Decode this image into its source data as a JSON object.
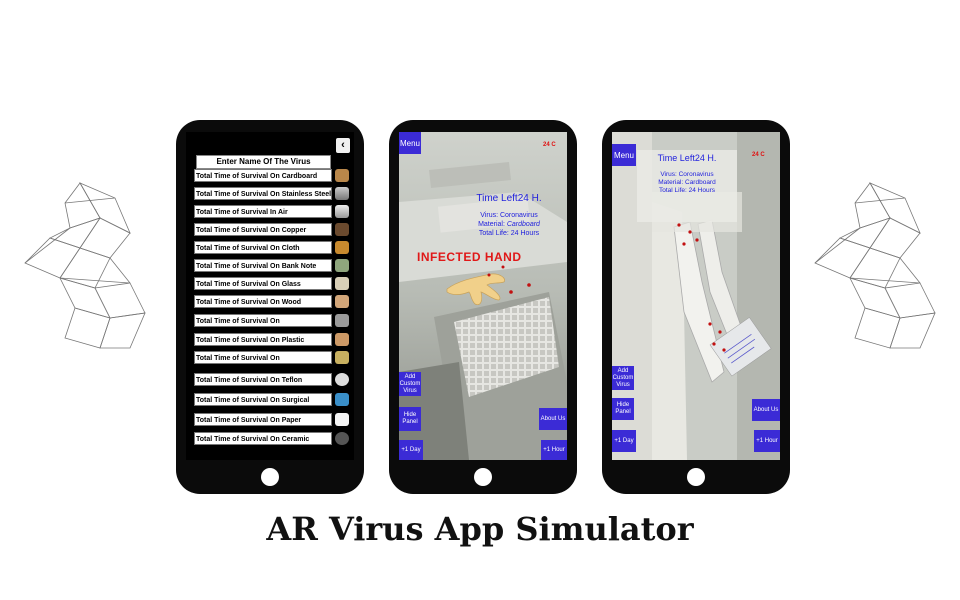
{
  "caption": "AR Virus App Simulator",
  "phone1": {
    "back_icon": "back-arrow-icon",
    "title": "Enter Name Of The Virus",
    "items": [
      {
        "label": "Total Time of Survival On Cardboard",
        "icon": "cardboard-icon"
      },
      {
        "label": "Total Time of Survival On Stainless Steel",
        "icon": "steel-icon"
      },
      {
        "label": "Total Time of Survival In Air",
        "icon": "air-icon"
      },
      {
        "label": "Total Time of Survival On Copper",
        "icon": "copper-icon"
      },
      {
        "label": "Total Time of Survival On Cloth",
        "icon": "cloth-icon"
      },
      {
        "label": "Total Time of Survival On Bank Note",
        "icon": "banknote-icon"
      },
      {
        "label": "Total Time of Survival On Glass",
        "icon": "glass-icon"
      },
      {
        "label": "Total Time of Survival On Wood",
        "icon": "wood-icon"
      },
      {
        "label": "Total Time of Survival On",
        "icon": "bin-icon"
      },
      {
        "label": "Total Time of Survival On Plastic",
        "icon": "plastic-icon"
      },
      {
        "label": "Total Time of Survival On",
        "icon": "bottle-icon"
      },
      {
        "label": "Total Time of Survival On Teflon",
        "icon": "teflon-icon"
      },
      {
        "label": "Total Time of Survival On Surgical",
        "icon": "surgical-icon"
      },
      {
        "label": "Total Time of Survival On Paper",
        "icon": "paper-icon"
      },
      {
        "label": "Total Time of Survival On Ceramic",
        "icon": "ceramic-icon"
      }
    ]
  },
  "phone2": {
    "menu": "Menu",
    "temperature": "24 C",
    "time_left": "Time Left24 H.",
    "virus": "Virus: Coronavirus",
    "material_label": "Material: ",
    "material_value": "Cardboard",
    "total_life": "Total Life: 24 Hours",
    "infected": "INFECTED HAND",
    "add_custom": "Add Custom Virus",
    "hide_panel": "Hide Panel",
    "about_us": "About Us",
    "plus_day": "+1 Day",
    "plus_hour": "+1 Hour"
  },
  "phone3": {
    "menu": "Menu",
    "temperature": "24 C",
    "time_left": "Time Left24 H.",
    "virus": "Virus: Coronavirus",
    "material": "Material: Cardboard",
    "total_life": "Total Life: 24 Hours",
    "add_custom": "Add Custom Virus",
    "hide_panel": "Hide Panel",
    "about_us": "About Us",
    "plus_day": "+1 Day",
    "plus_hour": "+1 Hour"
  }
}
